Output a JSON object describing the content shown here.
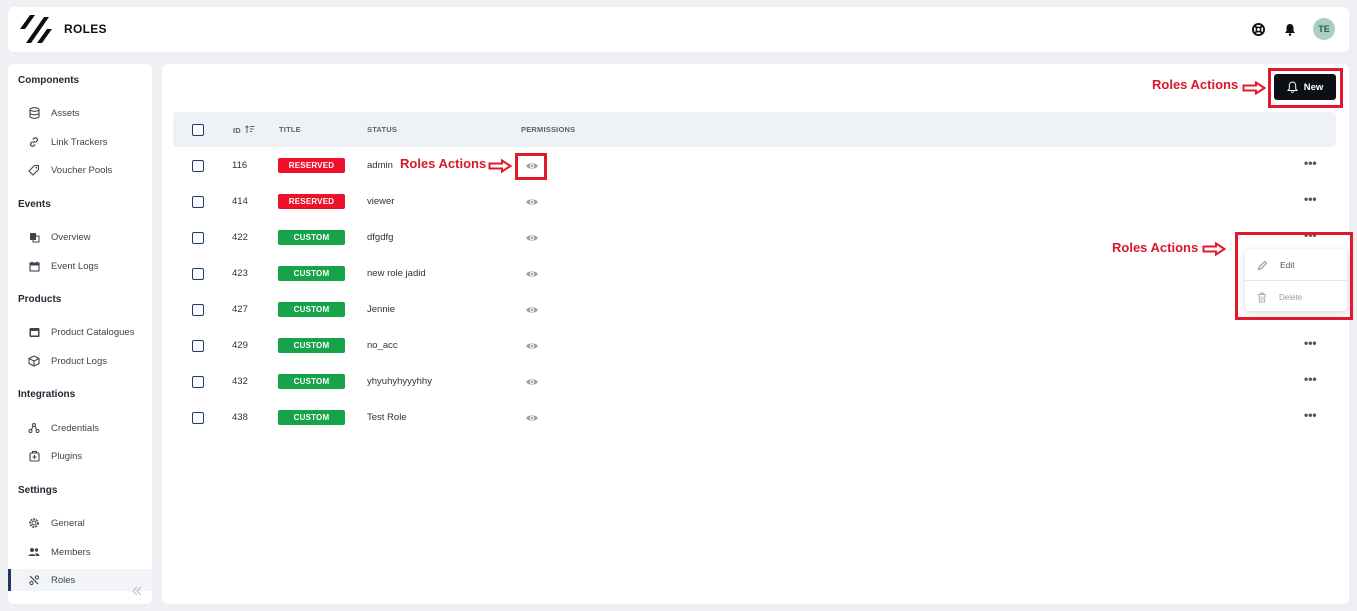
{
  "app": {
    "title": "ROLES",
    "avatar_initials": "TE"
  },
  "sidebar": {
    "sections": [
      {
        "title": "Components",
        "items": [
          {
            "label": "Assets",
            "icon": "database-icon"
          },
          {
            "label": "Link Trackers",
            "icon": "link-icon"
          },
          {
            "label": "Voucher Pools",
            "icon": "tag-icon"
          }
        ]
      },
      {
        "title": "Events",
        "items": [
          {
            "label": "Overview",
            "icon": "overview-icon"
          },
          {
            "label": "Event Logs",
            "icon": "calendar-icon"
          }
        ]
      },
      {
        "title": "Products",
        "items": [
          {
            "label": "Product Catalogues",
            "icon": "catalogue-icon"
          },
          {
            "label": "Product Logs",
            "icon": "box-icon"
          }
        ]
      },
      {
        "title": "Integrations",
        "items": [
          {
            "label": "Credentials",
            "icon": "credentials-icon"
          },
          {
            "label": "Plugins",
            "icon": "plugin-icon"
          }
        ]
      },
      {
        "title": "Settings",
        "items": [
          {
            "label": "General",
            "icon": "gear-icon"
          },
          {
            "label": "Members",
            "icon": "members-icon"
          },
          {
            "label": "Roles",
            "icon": "roles-icon",
            "active": true
          }
        ]
      }
    ]
  },
  "toolbar": {
    "new_label": "New"
  },
  "table": {
    "headers": {
      "id": "ID",
      "title": "TITLE",
      "status": "STATUS",
      "permissions": "PERMISSIONS"
    },
    "rows": [
      {
        "id": "116",
        "title": "RESERVED",
        "status": "admin"
      },
      {
        "id": "414",
        "title": "RESERVED",
        "status": "viewer"
      },
      {
        "id": "422",
        "title": "CUSTOM",
        "status": "dfgdfg"
      },
      {
        "id": "423",
        "title": "CUSTOM",
        "status": "new role jadid"
      },
      {
        "id": "427",
        "title": "CUSTOM",
        "status": "Jennie"
      },
      {
        "id": "429",
        "title": "CUSTOM",
        "status": "no_acc"
      },
      {
        "id": "432",
        "title": "CUSTOM",
        "status": "yhyuhyhyyyhhy"
      },
      {
        "id": "438",
        "title": "CUSTOM",
        "status": "Test Role"
      }
    ]
  },
  "row_menu": {
    "edit_label": "Edit",
    "delete_label": "Delete"
  },
  "annotations": {
    "label": "Roles Actions",
    "color": "#e2192c"
  },
  "colors": {
    "reserved": "#f0102a",
    "custom": "#16a34a",
    "accent": "#1f3a66"
  }
}
